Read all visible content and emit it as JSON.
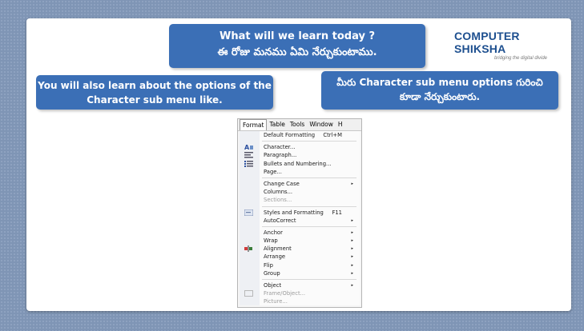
{
  "title_box": {
    "line1": "What will we learn today ?",
    "line2": "ఈ రోజు మనము ఏమి నేర్చుకుంటాము."
  },
  "logo": {
    "main": "COMPUTER SHIKSHA",
    "tagline": "bridging the digital divide"
  },
  "left_box": {
    "line1": "You will also learn about the options of the",
    "line2": "Character sub menu like."
  },
  "right_box": {
    "line1": "మీరు Character sub menu options గురించి",
    "line2": "కూడా నేర్చుకుంటారు."
  },
  "menubar": [
    "Format",
    "Table",
    "Tools",
    "Window",
    "H"
  ],
  "menu_groups": [
    [
      {
        "label": "Default Formatting",
        "shortcut": "Ctrl+M"
      }
    ],
    [
      {
        "label": "Character...",
        "icon": "character-icon"
      },
      {
        "label": "Paragraph...",
        "icon": "paragraph-icon"
      },
      {
        "label": "Bullets and Numbering...",
        "icon": "bullets-icon"
      },
      {
        "label": "Page..."
      }
    ],
    [
      {
        "label": "Change Case",
        "submenu": true
      },
      {
        "label": "Columns..."
      },
      {
        "label": "Sections...",
        "disabled": true
      }
    ],
    [
      {
        "label": "Styles and Formatting",
        "shortcut": "F11",
        "icon": "styles-icon"
      },
      {
        "label": "AutoCorrect",
        "submenu": true
      }
    ],
    [
      {
        "label": "Anchor",
        "submenu": true
      },
      {
        "label": "Wrap",
        "submenu": true
      },
      {
        "label": "Alignment",
        "submenu": true,
        "icon": "alignment-icon"
      },
      {
        "label": "Arrange",
        "submenu": true
      },
      {
        "label": "Flip",
        "submenu": true
      },
      {
        "label": "Group",
        "submenu": true
      }
    ],
    [
      {
        "label": "Object",
        "submenu": true
      },
      {
        "label": "Frame/Object...",
        "disabled": true,
        "icon": "frame-icon"
      },
      {
        "label": "Picture...",
        "disabled": true
      }
    ]
  ]
}
